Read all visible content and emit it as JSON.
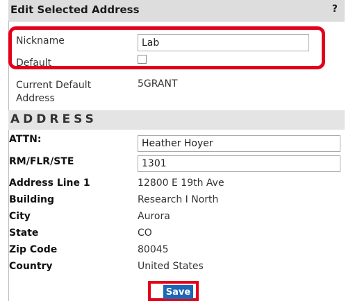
{
  "header": {
    "title": "Edit Selected Address",
    "help": "?"
  },
  "nickname": {
    "label": "Nickname",
    "value": "Lab"
  },
  "default": {
    "label": "Default",
    "checked": false
  },
  "current_default": {
    "label_line1": "Current Default",
    "label_line2": "Address",
    "value": "5GRANT"
  },
  "section": {
    "title": "ADDRESS"
  },
  "fields": {
    "attn": {
      "label": "ATTN:",
      "value": "Heather Hoyer"
    },
    "rm": {
      "label": "RM/FLR/STE",
      "value": "1301"
    },
    "address1": {
      "label": "Address Line 1",
      "value": "12800 E 19th Ave"
    },
    "building": {
      "label": "Building",
      "value": "Research I North"
    },
    "city": {
      "label": "City",
      "value": "Aurora"
    },
    "state": {
      "label": "State",
      "value": "CO"
    },
    "zip": {
      "label": "Zip Code",
      "value": "80045"
    },
    "country": {
      "label": "Country",
      "value": "United States"
    }
  },
  "actions": {
    "save_label": "Save"
  },
  "colors": {
    "highlight": "#e3001b",
    "button": "#1e67b5",
    "header_bg": "#dddddd"
  }
}
